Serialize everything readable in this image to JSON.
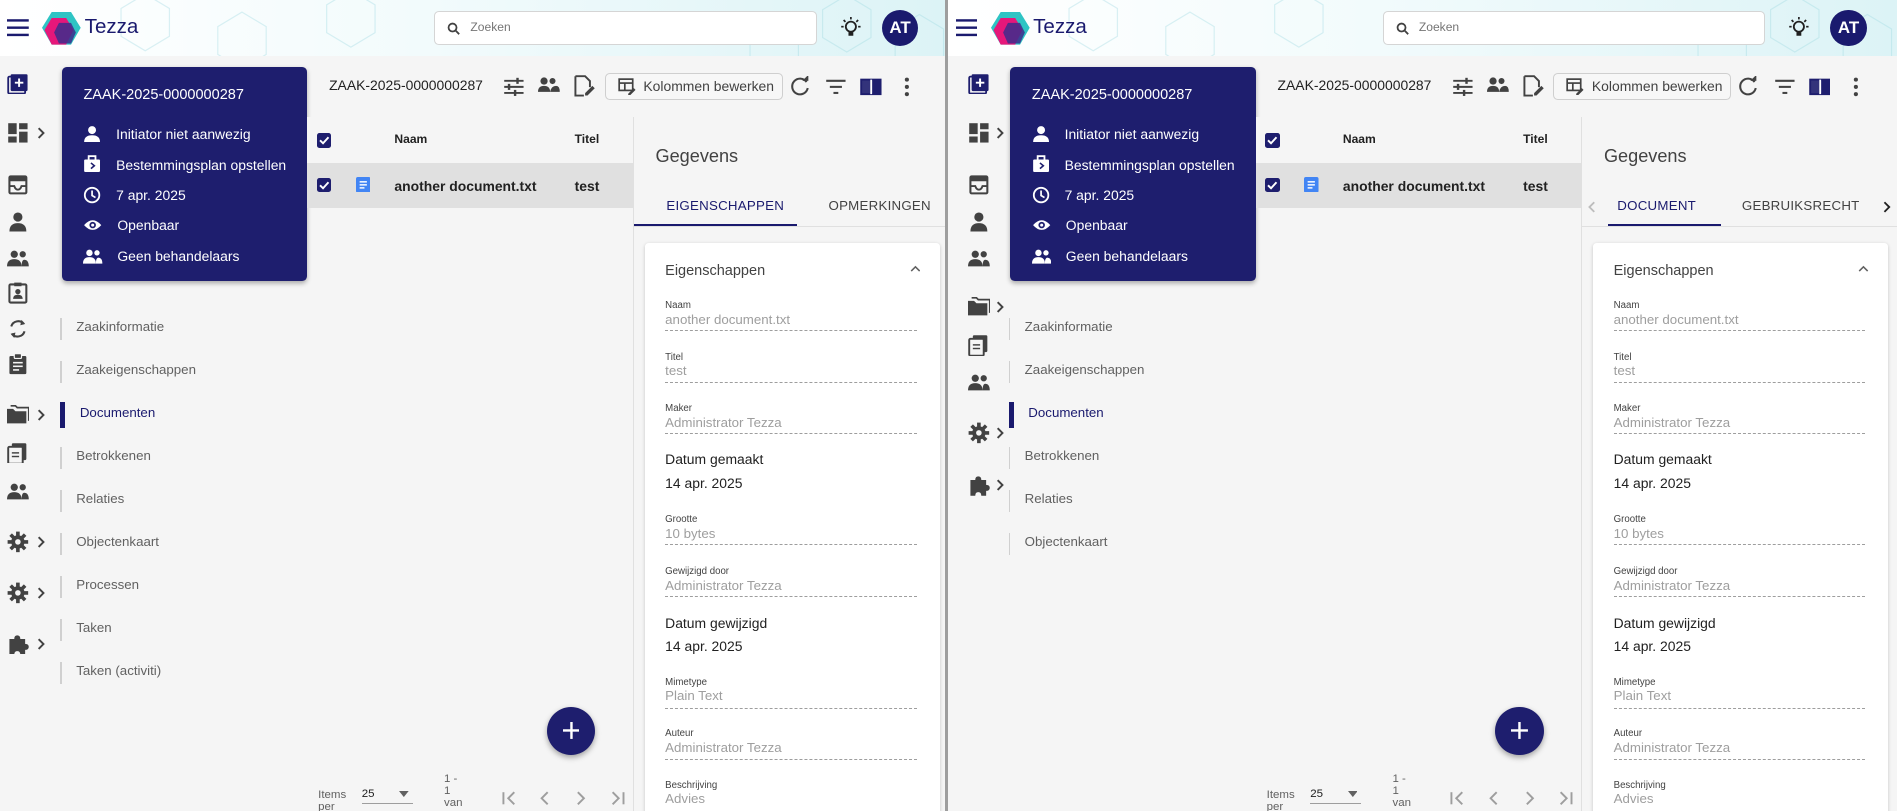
{
  "panes": [
    {
      "id": "left",
      "app": {
        "name": "Tezza"
      },
      "search": {
        "placeholder": "Zoeken"
      },
      "user": {
        "initials": "AT"
      },
      "case_card": {
        "case_number": "ZAAK-2025-0000000287",
        "initiator": "Initiator niet aanwezig",
        "case_type": "Bestemmingsplan opstellen",
        "date": "7 apr. 2025",
        "visibility": "Openbaar",
        "handlers": "Geen behandelaars"
      },
      "side_nav": [
        {
          "label": "Zaakinformatie",
          "active": false
        },
        {
          "label": "Zaakeigenschappen",
          "active": false
        },
        {
          "label": "Documenten",
          "active": true
        },
        {
          "label": "Betrokkenen",
          "active": false
        },
        {
          "label": "Relaties",
          "active": false
        },
        {
          "label": "Objectenkaart",
          "active": false
        },
        {
          "label": "Processen",
          "active": false
        },
        {
          "label": "Taken",
          "active": false
        },
        {
          "label": "Taken (activiti)",
          "active": false
        }
      ],
      "documents": {
        "title": "ZAAK-2025-0000000287",
        "columns_button": "Kolommen bewerken",
        "columns": [
          "Naam",
          "Titel"
        ],
        "rows": [
          {
            "name": "another document.txt",
            "title": "test"
          }
        ],
        "paginator": {
          "items_per_label": "Items per",
          "page_size": "25",
          "range": "1 - 1 van"
        }
      },
      "details": {
        "heading": "Gegevens",
        "tabs": [
          {
            "label": "EIGENSCHAPPEN",
            "active": true
          },
          {
            "label": "OPMERKINGEN",
            "active": false
          }
        ],
        "section_title": "Eigenschappen",
        "fields": {
          "naam": {
            "label": "Naam",
            "value": "another document.txt"
          },
          "titel": {
            "label": "Titel",
            "value": "test"
          },
          "maker": {
            "label": "Maker",
            "value": "Administrator Tezza"
          },
          "datum_gemaakt": {
            "label": "Datum gemaakt",
            "value": "14 apr. 2025"
          },
          "grootte": {
            "label": "Grootte",
            "value": "10 bytes"
          },
          "gewijzigd_door": {
            "label": "Gewijzigd door",
            "value": "Administrator Tezza"
          },
          "datum_gewijzigd": {
            "label": "Datum gewijzigd",
            "value": "14 apr. 2025"
          },
          "mimetype": {
            "label": "Mimetype",
            "value": "Plain Text"
          },
          "auteur": {
            "label": "Auteur",
            "value": "Administrator Tezza"
          },
          "beschrijving": {
            "label": "Beschrijving",
            "value": "Advies"
          }
        }
      }
    },
    {
      "id": "right",
      "app": {
        "name": "Tezza"
      },
      "search": {
        "placeholder": "Zoeken"
      },
      "user": {
        "initials": "AT"
      },
      "case_card": {
        "case_number": "ZAAK-2025-0000000287",
        "initiator": "Initiator niet aanwezig",
        "case_type": "Bestemmingsplan opstellen",
        "date": "7 apr. 2025",
        "visibility": "Openbaar",
        "handlers": "Geen behandelaars"
      },
      "side_nav": [
        {
          "label": "Zaakinformatie",
          "active": false
        },
        {
          "label": "Zaakeigenschappen",
          "active": false
        },
        {
          "label": "Documenten",
          "active": true
        },
        {
          "label": "Betrokkenen",
          "active": false
        },
        {
          "label": "Relaties",
          "active": false
        },
        {
          "label": "Objectenkaart",
          "active": false
        }
      ],
      "documents": {
        "title": "ZAAK-2025-0000000287",
        "columns_button": "Kolommen bewerken",
        "columns": [
          "Naam",
          "Titel"
        ],
        "rows": [
          {
            "name": "another document.txt",
            "title": "test"
          }
        ],
        "paginator": {
          "items_per_label": "Items per",
          "page_size": "25",
          "range": "1 - 1 van"
        }
      },
      "details": {
        "heading": "Gegevens",
        "tabs": [
          {
            "label": "DOCUMENT",
            "active": true
          },
          {
            "label": "GEBRUIKSRECHT",
            "active": false
          }
        ],
        "section_title": "Eigenschappen",
        "fields": {
          "naam": {
            "label": "Naam",
            "value": "another document.txt"
          },
          "titel": {
            "label": "Titel",
            "value": "test"
          },
          "maker": {
            "label": "Maker",
            "value": "Administrator Tezza"
          },
          "datum_gemaakt": {
            "label": "Datum gemaakt",
            "value": "14 apr. 2025"
          },
          "grootte": {
            "label": "Grootte",
            "value": "10 bytes"
          },
          "gewijzigd_door": {
            "label": "Gewijzigd door",
            "value": "Administrator Tezza"
          },
          "datum_gewijzigd": {
            "label": "Datum gewijzigd",
            "value": "14 apr. 2025"
          },
          "mimetype": {
            "label": "Mimetype",
            "value": "Plain Text"
          },
          "auteur": {
            "label": "Auteur",
            "value": "Administrator Tezza"
          },
          "beschrijving": {
            "label": "Beschrijving",
            "value": "Advies"
          }
        }
      }
    }
  ],
  "rail": {
    "left": [
      "add-box-icon",
      "dashboard-icon",
      "inbox-icon",
      "person-icon",
      "group-icon",
      "contact-card-icon",
      "sync-icon",
      "clipboard-icon",
      "folders-icon",
      "documents-icon",
      "group-icon",
      "gear-icon",
      "gear-icon",
      "puzzle-icon"
    ],
    "right": [
      "add-box-icon",
      "dashboard-icon",
      "inbox-icon",
      "person-icon",
      "group-icon",
      "folders-icon",
      "documents-icon",
      "group-icon",
      "gear-icon",
      "puzzle-icon"
    ]
  },
  "colors": {
    "primary": "#1e1e6e",
    "brand_teal": "#2ec4c4",
    "brand_pink": "#e6177a",
    "row_selected": "#e0e0e0"
  }
}
